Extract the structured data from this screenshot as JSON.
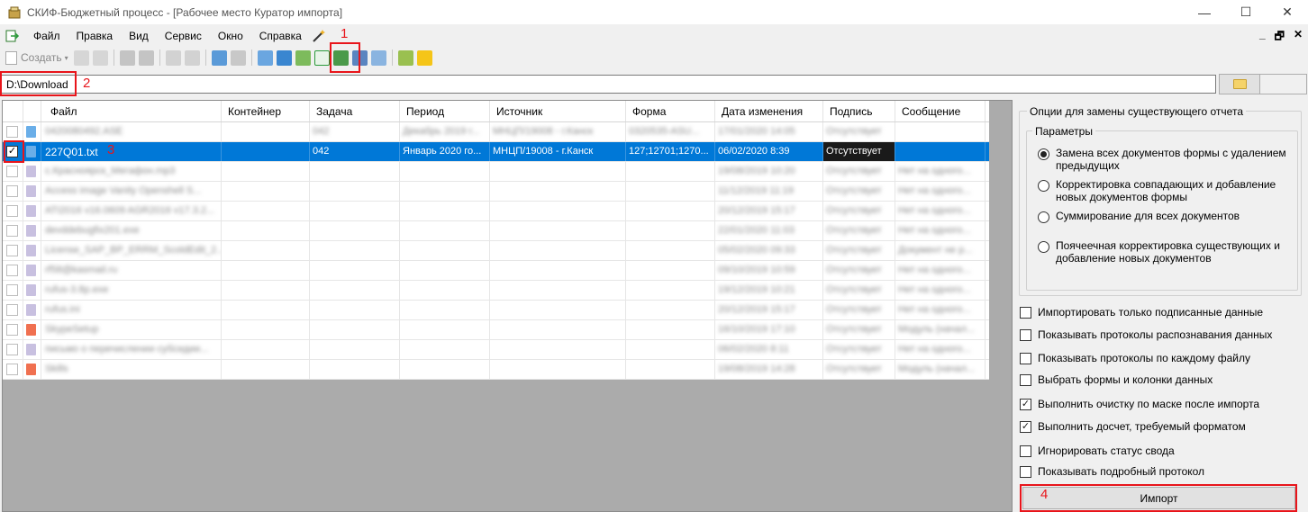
{
  "window": {
    "title": "СКИФ-Бюджетный процесс - [Рабочее место Куратор импорта]",
    "minimize": "—",
    "maximize": "☐",
    "close": "✕"
  },
  "menu": {
    "items": [
      "Файл",
      "Правка",
      "Вид",
      "Сервис",
      "Окно",
      "Справка"
    ],
    "mdi": {
      "minimize": "_",
      "restore": "🗗",
      "close": "✕"
    }
  },
  "toolbar": {
    "create_label": "Создать",
    "highlight_colors": [
      "#1a7ad4",
      "#2a9a3a",
      "#d48a1a"
    ]
  },
  "annotations": {
    "n1": "1",
    "n2": "2",
    "n3": "3",
    "n4": "4",
    "color": "#e8151b"
  },
  "path": {
    "value": "D:\\Download"
  },
  "grid": {
    "columns": [
      "Файл",
      "Контейнер",
      "Задача",
      "Период",
      "Источник",
      "Форма",
      "Дата изменения",
      "Подпись",
      "Сообщение"
    ],
    "selected_row": {
      "file": "227Q01.txt",
      "container": "",
      "task": "042",
      "period": "Январь 2020 го...",
      "source": "МНЦП/19008 - г.Канск",
      "form": "127;12701;1270...",
      "date": "06/02/2020 8:39",
      "signature": "Отсутствует",
      "message": ""
    },
    "blurred_rows": [
      {
        "file": "0420080492.ASE",
        "task": "042",
        "period": "Декабрь 2019 г...",
        "source": "МНЦП/19008 - г.Канск",
        "form": "0320535-ASU...",
        "date": "17/01/2020 14:05",
        "sig": "Отсутствует",
        "msg": ""
      },
      {
        "file": "с.Красноярск_Мегафон.mp3",
        "task": "",
        "period": "",
        "source": "",
        "form": "",
        "date": "19/08/2019 10:20",
        "sig": "Отсутствует",
        "msg": "Нет на одного..."
      },
      {
        "file": "Access image Vanity Openshell S...",
        "task": "",
        "period": "",
        "source": "",
        "form": "",
        "date": "11/12/2019 11:19",
        "sig": "Отсутствует",
        "msg": "Нет на одного..."
      },
      {
        "file": "ATI2016 v16.0609 AGR2016 v17.3.2...",
        "task": "",
        "period": "",
        "source": "",
        "form": "",
        "date": "20/12/2019 15:17",
        "sig": "Отсутствует",
        "msg": "Нет на одного..."
      },
      {
        "file": "devddebugfix201.exe",
        "task": "",
        "period": "",
        "source": "",
        "form": "",
        "date": "22/01/2020 11:03",
        "sig": "Отсутствует",
        "msg": "Нет на одного..."
      },
      {
        "file": "License_SAP_BP_ERRM_ScoldEdit_2...",
        "task": "",
        "period": "",
        "source": "",
        "form": "",
        "date": "05/02/2020 09:33",
        "sig": "Отсутствует",
        "msg": "Документ не р..."
      },
      {
        "file": "rf58@kasmail.ru",
        "task": "",
        "period": "",
        "source": "",
        "form": "",
        "date": "09/10/2019 10:59",
        "sig": "Отсутствует",
        "msg": "Нет на одного..."
      },
      {
        "file": "rufus-3.8p.exe",
        "task": "",
        "period": "",
        "source": "",
        "form": "",
        "date": "19/12/2019 10:21",
        "sig": "Отсутствует",
        "msg": "Нет на одного..."
      },
      {
        "file": "rufus.ini",
        "task": "",
        "period": "",
        "source": "",
        "form": "",
        "date": "20/12/2019 15:17",
        "sig": "Отсутствует",
        "msg": "Нет на одного..."
      },
      {
        "file": "SkypeSetup",
        "task": "",
        "period": "",
        "source": "",
        "form": "",
        "date": "16/10/2019 17:10",
        "sig": "Отсутствует",
        "msg": "Модуль (начал..."
      },
      {
        "file": "письмо о перечислении субсидии...",
        "task": "",
        "period": "",
        "source": "",
        "form": "",
        "date": "06/02/2020 8:11",
        "sig": "Отсутствует",
        "msg": "Нет на одного..."
      },
      {
        "file": "Skills",
        "task": "",
        "period": "",
        "source": "",
        "form": "",
        "date": "19/08/2019 14:28",
        "sig": "Отсутствует",
        "msg": "Модуль (начал..."
      }
    ]
  },
  "options": {
    "group_title": "Опции для замены существующего отчета",
    "params_title": "Параметры",
    "radios": [
      {
        "label": "Замена всех документов формы с удалением предыдущих",
        "checked": true
      },
      {
        "label": "Корректировка совпадающих и добавление новых документов формы",
        "checked": false
      },
      {
        "label": "Суммирование для всех документов",
        "checked": false
      },
      {
        "label": "Поячеечная корректировка существующих и добавление новых документов",
        "checked": false
      }
    ],
    "checkboxes": [
      {
        "label": "Импортировать только подписанные данные",
        "checked": false
      },
      {
        "label": "Показывать протоколы распознавания данных",
        "checked": false
      },
      {
        "label": "Показывать протоколы по каждому файлу",
        "checked": false
      },
      {
        "label": "Выбрать формы и колонки данных",
        "checked": false
      },
      {
        "label": "Выполнить очистку по маске после импорта",
        "checked": true
      },
      {
        "label": "Выполнить досчет, требуемый форматом",
        "checked": true
      },
      {
        "label": "Игнорировать статус свода",
        "checked": false
      },
      {
        "label": "Показывать подробный протокол",
        "checked": false
      }
    ],
    "import_label": "Импорт"
  }
}
